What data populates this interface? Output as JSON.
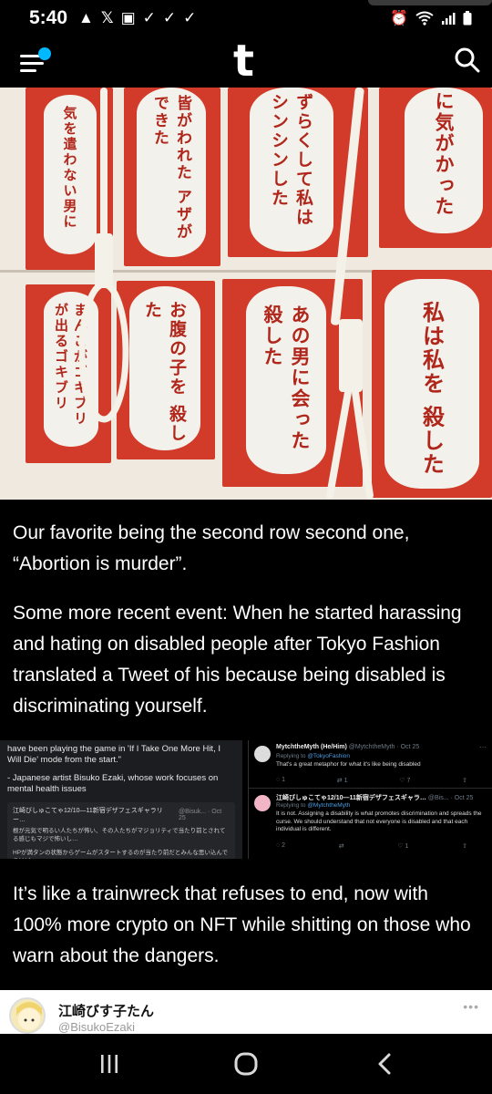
{
  "status_bar": {
    "time": "5:40",
    "left_icons": [
      "warning-icon",
      "x-icon",
      "image-icon",
      "check-icon",
      "check-icon",
      "check-icon"
    ],
    "right_icons": [
      "alarm-icon",
      "wifi-icon",
      "signal-icon",
      "battery-icon"
    ]
  },
  "header": {
    "logo": "t",
    "accent_color": "#00b8ff"
  },
  "hero": {
    "top_row": [
      "気を遣わない男に",
      "皆がわれた アザができた",
      "ずらくして私は シンシンした",
      "に気がかった"
    ],
    "bottom_row": [
      "まんこがゴキブリ が出るゴキブリ",
      "お腹の子を 殺した",
      "あの男に会った 殺した",
      "私は私を 殺した"
    ]
  },
  "post": {
    "paragraph_1": "Our favorite being the second row second one, “Abortion is murder”.",
    "paragraph_2": "Some more recent event: When he started harassing and hating on disabled people after Tokyo Fashion translated a Tweet of his because being disabled is discriminating yourself.",
    "paragraph_3": "It’s like a trainwreck that refuses to end, now with 100% more crypto on NFT while shitting on those who warn about the dangers."
  },
  "embed_left": {
    "quote": "have been playing the game in 'If I Take One More Hit, I Will Die' mode from the start.\"",
    "caption": "- Japanese artist Bisuko Ezaki, whose work focuses on mental health issues",
    "tweet_name": "江崎びしゅこてゃ12/10—11新宿デザフェスギャラリー…",
    "tweet_meta": "@Bisuk... · Oct 25",
    "tweet_body_1": "根が元気で明るい人たちが怖い、その人たちがマジョリティで当たり前とされてる感じもマジで怖いし…",
    "tweet_body_2": "HPが満タンの状態からゲームがスタートするのが当たり前だとみんな思い込んでるけど"
  },
  "embed_right": {
    "t1_name": "MytchtheMyth (He/Him)",
    "t1_handle": "@MytchtheMyth · Oct 25",
    "t1_reply_prefix": "Replying to ",
    "t1_reply_to": "@TokyoFashion",
    "t1_body": "That's a great metaphor for what it's like being disabled",
    "t1_counts": [
      "1",
      "1",
      "7",
      ""
    ],
    "t2_name": "江崎びしゅこてゃ12/10—11新宿デザフェスギャラ…",
    "t2_handle": "@Bis... · Oct 25",
    "t2_reply_prefix": "Replying to ",
    "t2_reply_to": "@MytchtheMyth",
    "t2_body": "It is not. Assigning a disability is what promotes discrimination and spreads the curse. We should understand that not everyone is disabled and that each individual is different.",
    "t2_counts": [
      "2",
      "",
      "1",
      ""
    ],
    "dots": "···"
  },
  "attribution": {
    "name": "江崎びす子たん",
    "handle": "@BisukoEzaki",
    "dots": "•••"
  }
}
